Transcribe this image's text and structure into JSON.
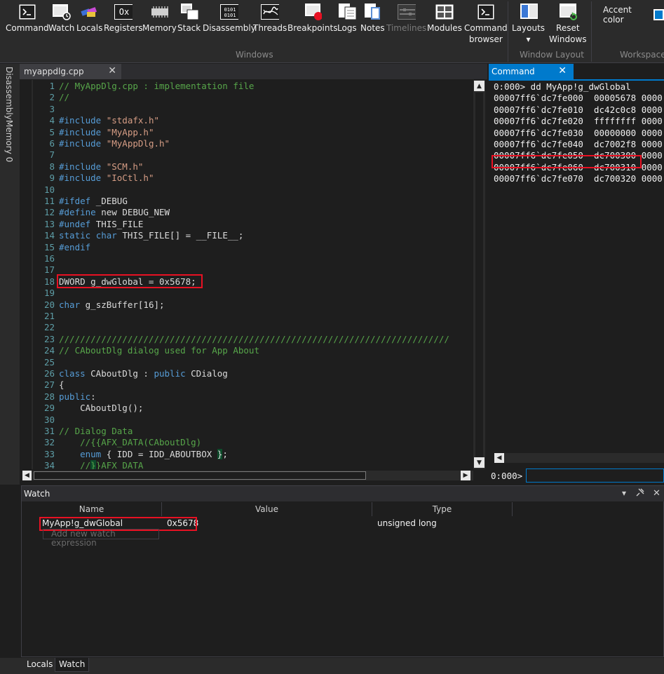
{
  "ribbon": {
    "groups": [
      {
        "label": "Windows",
        "buttons": [
          {
            "label": "Command",
            "icon": "command-window-icon"
          },
          {
            "label": "Watch",
            "icon": "watch-window-icon"
          },
          {
            "label": "Locals",
            "icon": "locals-window-icon"
          },
          {
            "label": "Registers",
            "icon": "registers-window-icon",
            "glyph": "Ox"
          },
          {
            "label": "Memory",
            "icon": "memory-chip-icon"
          },
          {
            "label": "Stack",
            "icon": "stack-window-icon"
          },
          {
            "label": "Disassembly",
            "icon": "disassembly-window-icon",
            "glyph": "0101"
          },
          {
            "label": "Threads",
            "icon": "threads-window-icon"
          },
          {
            "label": "Breakpoints",
            "icon": "breakpoints-window-icon"
          },
          {
            "label": "Logs",
            "icon": "logs-window-icon"
          },
          {
            "label": "Notes",
            "icon": "notes-window-icon"
          },
          {
            "label": "Timelines",
            "icon": "timelines-window-icon",
            "disabled": true
          },
          {
            "label": "Modules",
            "icon": "modules-window-icon"
          },
          {
            "label": "Command",
            "label2": "browser",
            "icon": "command-browser-icon"
          }
        ]
      },
      {
        "label": "Window Layout",
        "buttons": [
          {
            "label": "Layouts",
            "label2": "▾",
            "icon": "layouts-icon"
          },
          {
            "label": "Reset",
            "label2": "Windows",
            "icon": "reset-windows-icon"
          }
        ]
      },
      {
        "label": "Workspace",
        "buttons": [
          {
            "label": "Accent color",
            "icon": "accent-color-swatch-icon"
          }
        ]
      }
    ]
  },
  "left_tabs": [
    "Disassembly",
    "Memory 0"
  ],
  "editor": {
    "tab_title": "myappdlg.cpp",
    "lines": [
      {
        "n": "1",
        "parts": [
          {
            "t": "// MyAppDlg.cpp : implementation file",
            "c": "c"
          }
        ]
      },
      {
        "n": "2",
        "parts": [
          {
            "t": "//",
            "c": "c"
          }
        ]
      },
      {
        "n": "3",
        "parts": []
      },
      {
        "n": "4",
        "parts": [
          {
            "t": "#include ",
            "c": "p"
          },
          {
            "t": "\"stdafx.h\"",
            "c": "s"
          }
        ]
      },
      {
        "n": "5",
        "parts": [
          {
            "t": "#include ",
            "c": "p"
          },
          {
            "t": "\"MyApp.h\"",
            "c": "s"
          }
        ]
      },
      {
        "n": "6",
        "parts": [
          {
            "t": "#include ",
            "c": "p"
          },
          {
            "t": "\"MyAppDlg.h\"",
            "c": "s"
          }
        ]
      },
      {
        "n": "7",
        "parts": []
      },
      {
        "n": "8",
        "parts": [
          {
            "t": "#include ",
            "c": "p"
          },
          {
            "t": "\"SCM.h\"",
            "c": "s"
          }
        ]
      },
      {
        "n": "9",
        "parts": [
          {
            "t": "#include ",
            "c": "p"
          },
          {
            "t": "\"IoCtl.h\"",
            "c": "s"
          }
        ]
      },
      {
        "n": "10",
        "parts": []
      },
      {
        "n": "11",
        "parts": [
          {
            "t": "#ifdef ",
            "c": "p"
          },
          {
            "t": "_DEBUG",
            "c": "t"
          }
        ]
      },
      {
        "n": "12",
        "parts": [
          {
            "t": "#define ",
            "c": "p"
          },
          {
            "t": "new DEBUG_NEW",
            "c": "t"
          }
        ]
      },
      {
        "n": "13",
        "parts": [
          {
            "t": "#undef ",
            "c": "p"
          },
          {
            "t": "THIS_FILE",
            "c": "t"
          }
        ]
      },
      {
        "n": "14",
        "parts": [
          {
            "t": "static ",
            "c": "k"
          },
          {
            "t": "char ",
            "c": "k"
          },
          {
            "t": "THIS_FILE[] = __FILE__;",
            "c": "t"
          }
        ]
      },
      {
        "n": "15",
        "parts": [
          {
            "t": "#endif",
            "c": "p"
          }
        ]
      },
      {
        "n": "16",
        "parts": []
      },
      {
        "n": "17",
        "parts": []
      },
      {
        "n": "18",
        "parts": [
          {
            "t": "DWORD g_dwGlobal = 0x5678;",
            "c": "t"
          }
        ]
      },
      {
        "n": "19",
        "parts": []
      },
      {
        "n": "20",
        "parts": [
          {
            "t": "char ",
            "c": "k"
          },
          {
            "t": "g_szBuffer[16];",
            "c": "t"
          }
        ]
      },
      {
        "n": "21",
        "parts": []
      },
      {
        "n": "22",
        "parts": []
      },
      {
        "n": "23",
        "parts": [
          {
            "t": "//////////////////////////////////////////////////////////////////////////",
            "c": "c"
          }
        ]
      },
      {
        "n": "24",
        "parts": [
          {
            "t": "// CAboutDlg dialog used for App About",
            "c": "c"
          }
        ]
      },
      {
        "n": "25",
        "parts": []
      },
      {
        "n": "26",
        "parts": [
          {
            "t": "class ",
            "c": "k"
          },
          {
            "t": "CAboutDlg : ",
            "c": "t"
          },
          {
            "t": "public ",
            "c": "k"
          },
          {
            "t": "CDialog",
            "c": "t"
          }
        ]
      },
      {
        "n": "27",
        "parts": [
          {
            "t": "{",
            "c": "t"
          }
        ]
      },
      {
        "n": "28",
        "parts": [
          {
            "t": "public",
            "c": "k"
          },
          {
            "t": ":",
            "c": "t"
          }
        ]
      },
      {
        "n": "29",
        "parts": [
          {
            "t": "    CAboutDlg();",
            "c": "t"
          }
        ]
      },
      {
        "n": "30",
        "parts": []
      },
      {
        "n": "31",
        "parts": [
          {
            "t": "// Dialog Data",
            "c": "c"
          }
        ]
      },
      {
        "n": "32",
        "parts": [
          {
            "t": "    //{{AFX_DATA(CAboutDlg)",
            "c": "c"
          }
        ]
      },
      {
        "n": "33",
        "parts": [
          {
            "t": "    enum ",
            "c": "k"
          },
          {
            "t": "{ IDD = IDD_ABOUTBOX ",
            "c": "t"
          },
          {
            "t": "}",
            "c": "t",
            "hl": true
          },
          {
            "t": ";",
            "c": "t"
          }
        ]
      },
      {
        "n": "34",
        "parts": [
          {
            "t": "    //",
            "c": "c"
          },
          {
            "t": "}",
            "c": "c",
            "hl": true
          },
          {
            "t": "}AFX_DATA",
            "c": "c"
          }
        ]
      }
    ]
  },
  "command": {
    "tab_title": "Command",
    "output": [
      "0:000> dd MyApp!g_dwGlobal",
      "00007ff6`dc7fe000  00005678 0000",
      "00007ff6`dc7fe010  dc42c0c8 0000",
      "00007ff6`dc7fe020  ffffffff 0000",
      "00007ff6`dc7fe030  00000000 0000",
      "00007ff6`dc7fe040  dc7002f8 0000",
      "00007ff6`dc7fe050  dc700300 0000",
      "00007ff6`dc7fe060  dc700310 0000",
      "00007ff6`dc7fe070  dc700320 0000"
    ],
    "prompt": "0:000>",
    "input_value": ""
  },
  "watch": {
    "title": "Watch",
    "columns": [
      "Name",
      "Value",
      "Type"
    ],
    "rows": [
      {
        "name": "MyApp!g_dwGlobal",
        "value": "0x5678",
        "type": "unsigned long"
      }
    ],
    "add_placeholder": "Add new watch expression"
  },
  "bottom_tabs": [
    {
      "label": "Locals",
      "active": false
    },
    {
      "label": "Watch",
      "active": true
    }
  ],
  "colors": {
    "accent": "#007acc",
    "highlight_box": "#e81123",
    "comment": "#57a64a",
    "keyword": "#569cd6",
    "string": "#d69d85",
    "line_number": "#5e9ea7"
  }
}
